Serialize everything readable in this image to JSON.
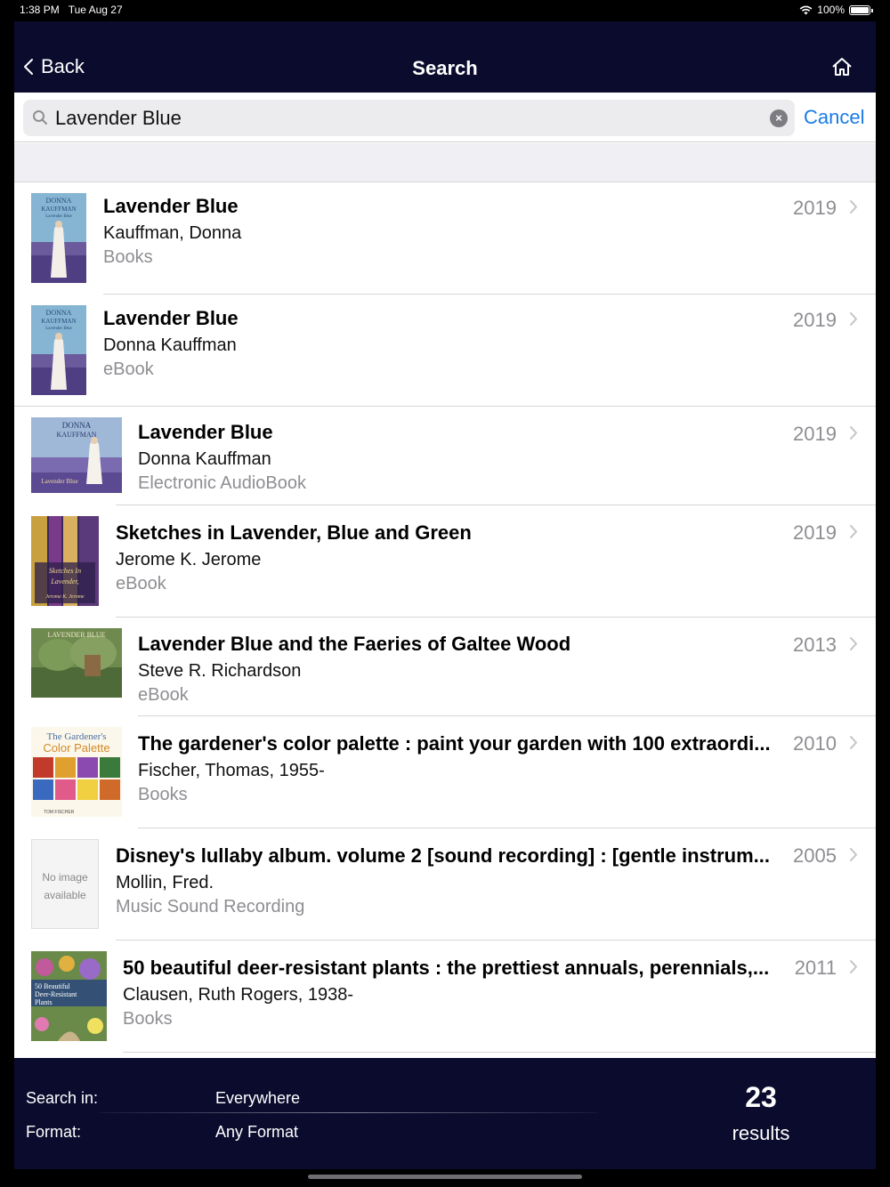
{
  "status_bar": {
    "time": "1:38 PM",
    "date": "Tue Aug 27",
    "battery": "100%"
  },
  "nav": {
    "back_label": "Back",
    "title": "Search",
    "home_icon": "home-icon"
  },
  "search": {
    "value": "Lavender Blue",
    "cancel_label": "Cancel"
  },
  "results": [
    {
      "title": "Lavender Blue",
      "author": "Kauffman, Donna",
      "format": "Books",
      "year": "2019",
      "cover_text": [
        "DONNA",
        "KAUFFMAN",
        "Lavender Blue"
      ]
    },
    {
      "title": "Lavender Blue",
      "author": "Donna Kauffman",
      "format": "eBook",
      "year": "2019",
      "cover_text": [
        "DONNA",
        "KAUFFMAN",
        "Lavender Blue"
      ]
    },
    {
      "title": "Lavender Blue",
      "author": "Donna Kauffman",
      "format": "Electronic AudioBook",
      "year": "2019",
      "cover_text": [
        "DONNA",
        "KAUFFMAN",
        "Lavender Blue"
      ]
    },
    {
      "title": "Sketches in Lavender, Blue and Green",
      "author": "Jerome K. Jerome",
      "format": "eBook",
      "year": "2019",
      "cover_text": [
        "Sketches In",
        "Lavender,",
        "Jerome K. Jerome"
      ]
    },
    {
      "title": "Lavender Blue and the Faeries of Galtee Wood",
      "author": "Steve R. Richardson",
      "format": "eBook",
      "year": "2013",
      "cover_text": [
        "LAVENDER BLUE"
      ]
    },
    {
      "title": "The gardener's color palette : paint your garden with 100 extraordi...",
      "author": "Fischer, Thomas, 1955-",
      "format": "Books",
      "year": "2010",
      "cover_text": [
        "The Gardener's",
        "Color Palette",
        "TOM FISCHER"
      ]
    },
    {
      "title": "Disney's lullaby album. volume 2 [sound recording] : [gentle instrum...",
      "author": "Mollin, Fred.",
      "format": "Music Sound Recording",
      "year": "2005",
      "cover_text": [
        "No image",
        "available"
      ]
    },
    {
      "title": "50 beautiful deer-resistant plants : the prettiest annuals, perennials,...",
      "author": "Clausen, Ruth Rogers, 1938-",
      "format": "Books",
      "year": "2011",
      "cover_text": [
        "50 Beautiful",
        "Deer-Resistant",
        "Plants"
      ]
    }
  ],
  "footer": {
    "search_in_label": "Search in:",
    "search_in_value": "Everywhere",
    "format_label": "Format:",
    "format_value": "Any Format",
    "count": "23",
    "count_label": "results"
  },
  "colors": {
    "navbar": "#0b0b2e",
    "accent": "#1a7be6",
    "secondary_text": "#8e8e93"
  }
}
